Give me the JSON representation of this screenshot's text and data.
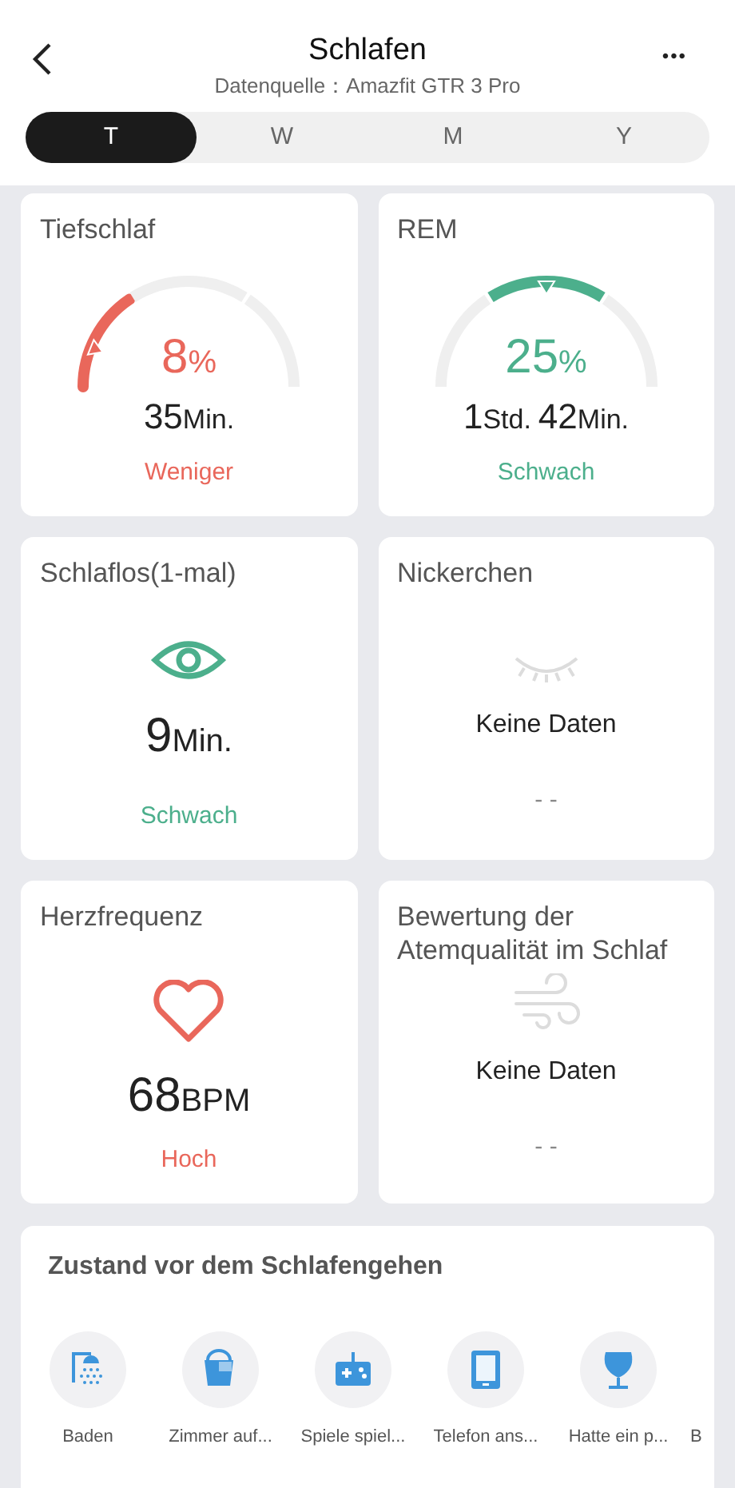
{
  "header": {
    "title": "Schlafen",
    "subtitle": "Datenquelle：Amazfit GTR 3 Pro",
    "more": "•••"
  },
  "tabs": [
    {
      "label": "T",
      "selected": true
    },
    {
      "label": "W",
      "selected": false
    },
    {
      "label": "M",
      "selected": false
    },
    {
      "label": "Y",
      "selected": false
    }
  ],
  "cards": [
    {
      "kind": "gauge",
      "title": "Tiefschlaf",
      "low": true,
      "color": "#e9675b",
      "percent": "8",
      "percent_unit": "%",
      "value": [
        {
          "number": "35",
          "unit": "Min."
        }
      ],
      "status": "Weniger"
    },
    {
      "kind": "gauge",
      "title": "REM",
      "low": false,
      "color": "#4caf8c",
      "percent": "25",
      "percent_unit": "%",
      "value": [
        {
          "number": "1",
          "unit": "Std."
        },
        {
          "number": "42",
          "unit": "Min."
        }
      ],
      "status": "Schwach"
    },
    {
      "kind": "eye",
      "title": "Schlaflos(1-mal)",
      "color": "#4caf8c",
      "value": [
        {
          "number": "9",
          "unit": "Min."
        }
      ],
      "status": "Schwach"
    },
    {
      "kind": "nap",
      "title": "Nickerchen",
      "empty": "Keine Daten",
      "dash": "- -"
    },
    {
      "kind": "heart",
      "title": "Herzfrequenz",
      "color": "#e9675b",
      "value": [
        {
          "number": "68",
          "unit": "BPM"
        }
      ],
      "status": "Hoch"
    },
    {
      "kind": "breath",
      "title": "Bewertung der Atemqualität im Schlaf",
      "empty": "Keine Daten",
      "dash": "- -"
    }
  ],
  "before_sleep": {
    "title": "Zustand vor dem Schlafengehen",
    "items": [
      {
        "kind": "shower",
        "label": "Baden"
      },
      {
        "kind": "bucket",
        "label": "Zimmer auf..."
      },
      {
        "kind": "game",
        "label": "Spiele spiel..."
      },
      {
        "kind": "phone",
        "label": "Telefon ans..."
      },
      {
        "kind": "glass",
        "label": "Hatte ein p..."
      },
      {
        "kind": "none",
        "label": "B"
      }
    ]
  }
}
